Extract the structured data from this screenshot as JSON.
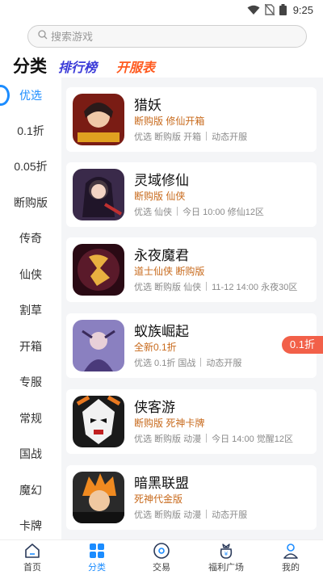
{
  "status_bar": {
    "time": "9:25"
  },
  "search": {
    "placeholder": "搜索游戏"
  },
  "top_tabs": {
    "category": "分类",
    "ranking": "排行榜",
    "server_list": "开服表"
  },
  "sidebar": {
    "items": [
      {
        "label": "优选",
        "active": true
      },
      {
        "label": "0.1折"
      },
      {
        "label": "0.05折"
      },
      {
        "label": "断购版"
      },
      {
        "label": "传奇"
      },
      {
        "label": "仙侠"
      },
      {
        "label": "割草"
      },
      {
        "label": "开箱"
      },
      {
        "label": "专服"
      },
      {
        "label": "常规"
      },
      {
        "label": "国战"
      },
      {
        "label": "魔幻"
      },
      {
        "label": "卡牌"
      }
    ]
  },
  "games": [
    {
      "name": "猎妖",
      "tags": "断购版 修仙开箱",
      "meta1": "优选 断购版 开箱",
      "meta2": "动态开服",
      "thumb_color": "#c0392b"
    },
    {
      "name": "灵域修仙",
      "tags": "断购版 仙侠",
      "meta1": "优选 仙侠",
      "meta2": "今日 10:00 修仙12区",
      "thumb_color": "#8e5a8a"
    },
    {
      "name": "永夜魔君",
      "tags": "道士仙侠 断购版",
      "meta1": "优选 断购版 仙侠",
      "meta2": "11-12 14:00 永夜30区",
      "thumb_color": "#5b1a2a"
    },
    {
      "name": "蚁族崛起",
      "tags": "全新0.1折",
      "meta1": "优选 0.1折 国战",
      "meta2": "动态开服",
      "discount": "0.1折",
      "thumb_color": "#6b5a9a"
    },
    {
      "name": "侠客游",
      "tags": "断购版 死神卡牌",
      "meta1": "优选 断购版 动漫",
      "meta2": "今日 14:00 觉醒12区",
      "thumb_color": "#e08020"
    },
    {
      "name": "暗黑联盟",
      "tags": "死神代金版",
      "meta1": "优选 断购版 动漫",
      "meta2": "动态开服",
      "thumb_color": "#d8801a"
    }
  ],
  "bottom_nav": [
    {
      "label": "首页",
      "icon": "home-icon"
    },
    {
      "label": "分类",
      "icon": "grid-icon",
      "active": true
    },
    {
      "label": "交易",
      "icon": "trade-icon"
    },
    {
      "label": "福利广场",
      "icon": "gift-bag-icon"
    },
    {
      "label": "我的",
      "icon": "profile-icon"
    }
  ],
  "colors": {
    "accent": "#1b8cff",
    "tag": "#c86a1c",
    "discount": "#f26049",
    "ranking": "#3a3ad8",
    "server": "#ff5a1f"
  }
}
